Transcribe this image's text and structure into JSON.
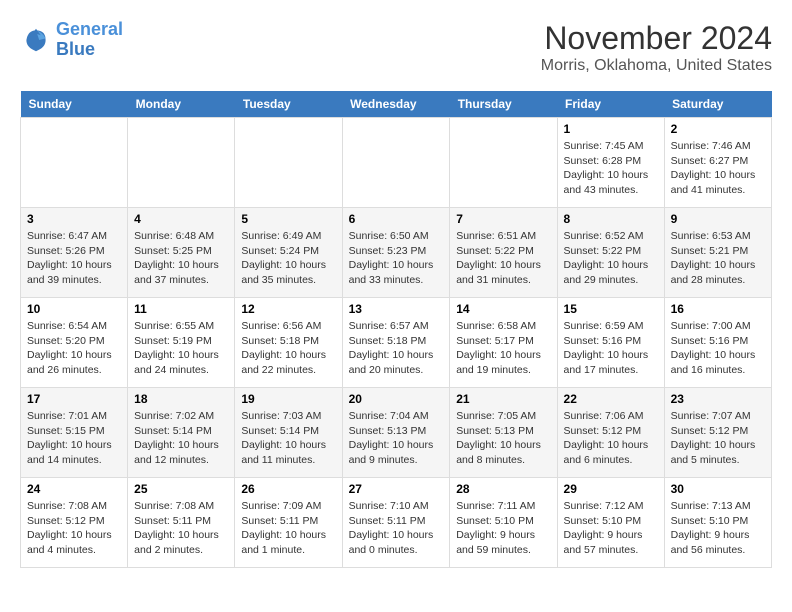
{
  "logo": {
    "line1": "General",
    "line2": "Blue"
  },
  "title": "November 2024",
  "location": "Morris, Oklahoma, United States",
  "weekdays": [
    "Sunday",
    "Monday",
    "Tuesday",
    "Wednesday",
    "Thursday",
    "Friday",
    "Saturday"
  ],
  "weeks": [
    [
      {
        "day": "",
        "info": ""
      },
      {
        "day": "",
        "info": ""
      },
      {
        "day": "",
        "info": ""
      },
      {
        "day": "",
        "info": ""
      },
      {
        "day": "",
        "info": ""
      },
      {
        "day": "1",
        "info": "Sunrise: 7:45 AM\nSunset: 6:28 PM\nDaylight: 10 hours and 43 minutes."
      },
      {
        "day": "2",
        "info": "Sunrise: 7:46 AM\nSunset: 6:27 PM\nDaylight: 10 hours and 41 minutes."
      }
    ],
    [
      {
        "day": "3",
        "info": "Sunrise: 6:47 AM\nSunset: 5:26 PM\nDaylight: 10 hours and 39 minutes."
      },
      {
        "day": "4",
        "info": "Sunrise: 6:48 AM\nSunset: 5:25 PM\nDaylight: 10 hours and 37 minutes."
      },
      {
        "day": "5",
        "info": "Sunrise: 6:49 AM\nSunset: 5:24 PM\nDaylight: 10 hours and 35 minutes."
      },
      {
        "day": "6",
        "info": "Sunrise: 6:50 AM\nSunset: 5:23 PM\nDaylight: 10 hours and 33 minutes."
      },
      {
        "day": "7",
        "info": "Sunrise: 6:51 AM\nSunset: 5:22 PM\nDaylight: 10 hours and 31 minutes."
      },
      {
        "day": "8",
        "info": "Sunrise: 6:52 AM\nSunset: 5:22 PM\nDaylight: 10 hours and 29 minutes."
      },
      {
        "day": "9",
        "info": "Sunrise: 6:53 AM\nSunset: 5:21 PM\nDaylight: 10 hours and 28 minutes."
      }
    ],
    [
      {
        "day": "10",
        "info": "Sunrise: 6:54 AM\nSunset: 5:20 PM\nDaylight: 10 hours and 26 minutes."
      },
      {
        "day": "11",
        "info": "Sunrise: 6:55 AM\nSunset: 5:19 PM\nDaylight: 10 hours and 24 minutes."
      },
      {
        "day": "12",
        "info": "Sunrise: 6:56 AM\nSunset: 5:18 PM\nDaylight: 10 hours and 22 minutes."
      },
      {
        "day": "13",
        "info": "Sunrise: 6:57 AM\nSunset: 5:18 PM\nDaylight: 10 hours and 20 minutes."
      },
      {
        "day": "14",
        "info": "Sunrise: 6:58 AM\nSunset: 5:17 PM\nDaylight: 10 hours and 19 minutes."
      },
      {
        "day": "15",
        "info": "Sunrise: 6:59 AM\nSunset: 5:16 PM\nDaylight: 10 hours and 17 minutes."
      },
      {
        "day": "16",
        "info": "Sunrise: 7:00 AM\nSunset: 5:16 PM\nDaylight: 10 hours and 16 minutes."
      }
    ],
    [
      {
        "day": "17",
        "info": "Sunrise: 7:01 AM\nSunset: 5:15 PM\nDaylight: 10 hours and 14 minutes."
      },
      {
        "day": "18",
        "info": "Sunrise: 7:02 AM\nSunset: 5:14 PM\nDaylight: 10 hours and 12 minutes."
      },
      {
        "day": "19",
        "info": "Sunrise: 7:03 AM\nSunset: 5:14 PM\nDaylight: 10 hours and 11 minutes."
      },
      {
        "day": "20",
        "info": "Sunrise: 7:04 AM\nSunset: 5:13 PM\nDaylight: 10 hours and 9 minutes."
      },
      {
        "day": "21",
        "info": "Sunrise: 7:05 AM\nSunset: 5:13 PM\nDaylight: 10 hours and 8 minutes."
      },
      {
        "day": "22",
        "info": "Sunrise: 7:06 AM\nSunset: 5:12 PM\nDaylight: 10 hours and 6 minutes."
      },
      {
        "day": "23",
        "info": "Sunrise: 7:07 AM\nSunset: 5:12 PM\nDaylight: 10 hours and 5 minutes."
      }
    ],
    [
      {
        "day": "24",
        "info": "Sunrise: 7:08 AM\nSunset: 5:12 PM\nDaylight: 10 hours and 4 minutes."
      },
      {
        "day": "25",
        "info": "Sunrise: 7:08 AM\nSunset: 5:11 PM\nDaylight: 10 hours and 2 minutes."
      },
      {
        "day": "26",
        "info": "Sunrise: 7:09 AM\nSunset: 5:11 PM\nDaylight: 10 hours and 1 minute."
      },
      {
        "day": "27",
        "info": "Sunrise: 7:10 AM\nSunset: 5:11 PM\nDaylight: 10 hours and 0 minutes."
      },
      {
        "day": "28",
        "info": "Sunrise: 7:11 AM\nSunset: 5:10 PM\nDaylight: 9 hours and 59 minutes."
      },
      {
        "day": "29",
        "info": "Sunrise: 7:12 AM\nSunset: 5:10 PM\nDaylight: 9 hours and 57 minutes."
      },
      {
        "day": "30",
        "info": "Sunrise: 7:13 AM\nSunset: 5:10 PM\nDaylight: 9 hours and 56 minutes."
      }
    ]
  ]
}
